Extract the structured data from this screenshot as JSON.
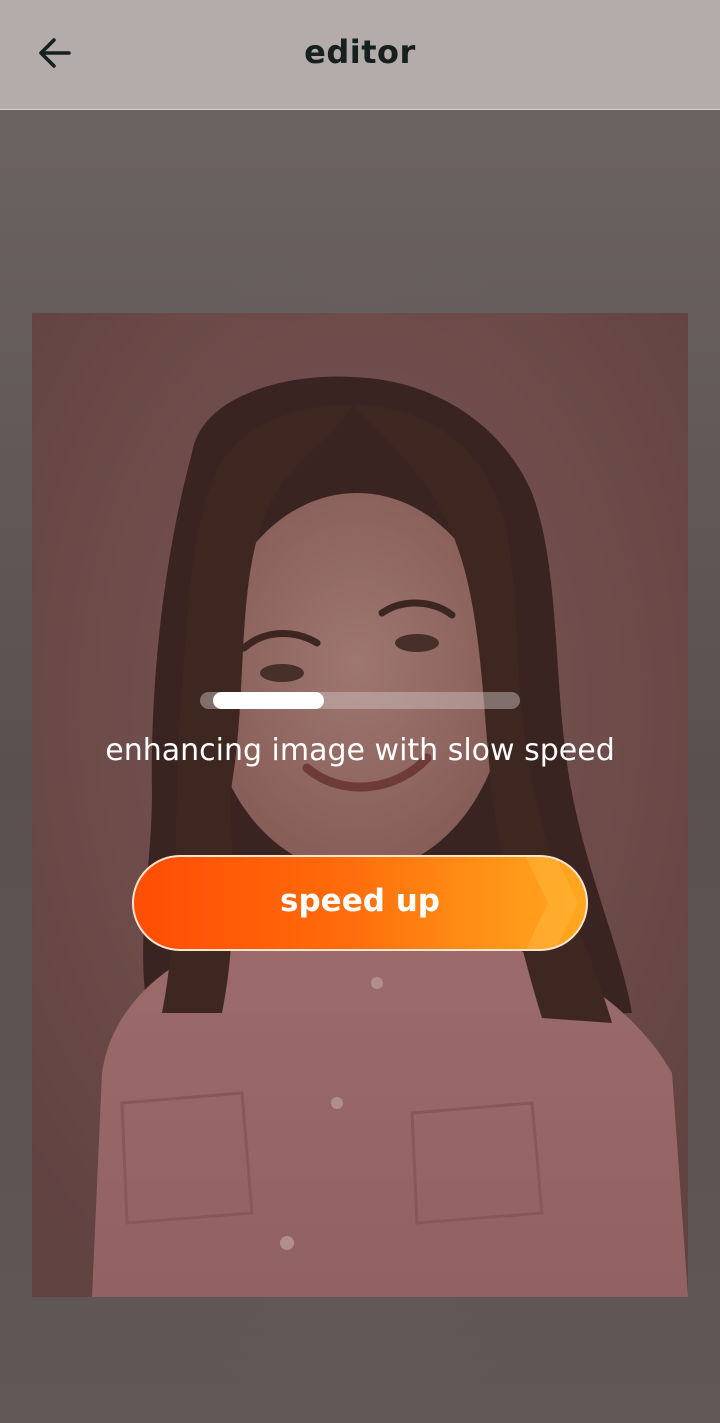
{
  "header": {
    "title": "editor",
    "back_icon": "arrow-left-icon"
  },
  "enhance": {
    "status_text": "enhancing image with slow speed",
    "progress": 0.36,
    "speed_up_label": "speed up"
  },
  "colors": {
    "topbar": "#b3acab",
    "button_start": "#ff4d05",
    "button_end": "#ffa81f",
    "title": "#16201e"
  }
}
